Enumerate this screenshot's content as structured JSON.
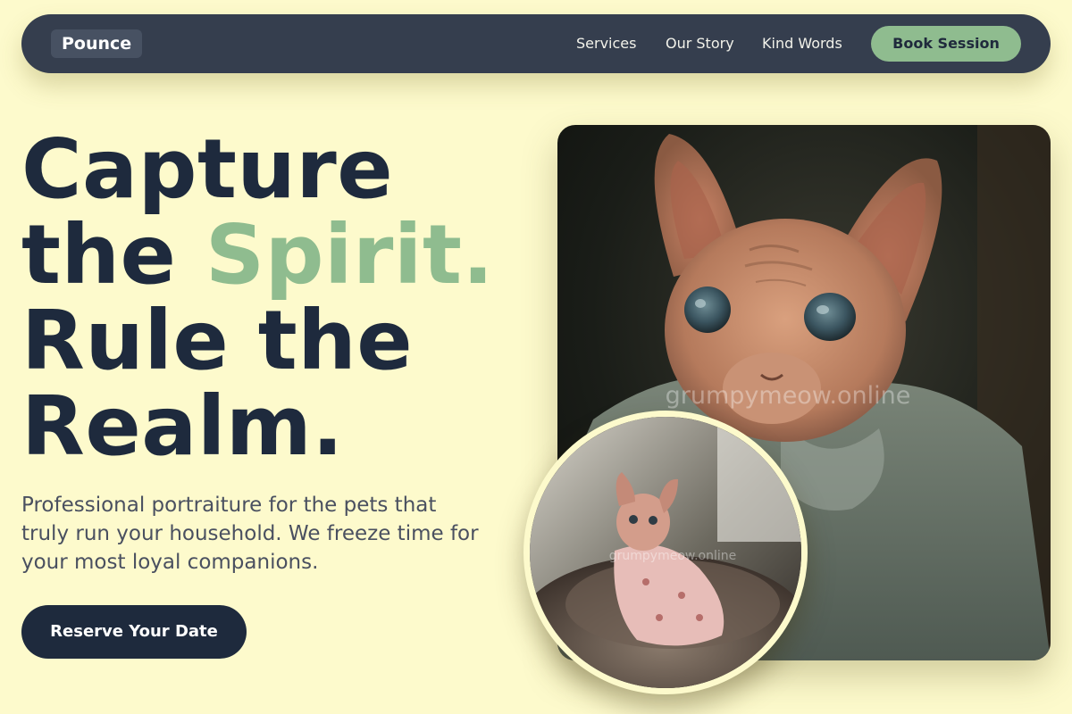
{
  "nav": {
    "logo": "Pounce",
    "links": [
      "Services",
      "Our Story",
      "Kind Words"
    ],
    "cta": "Book Session"
  },
  "hero": {
    "headline_line1": "Capture",
    "headline_line2_a": "the ",
    "headline_line2_accent": "Spirit.",
    "headline_line3": "Rule the",
    "headline_line4": "Realm.",
    "subtitle": "Professional portraiture for the pets that truly run your household. We freeze time for your most loyal companions.",
    "cta": "Reserve Your Date"
  },
  "images": {
    "main_watermark": "grumpymeow.online",
    "circle_watermark": "grumpymeow.online"
  },
  "colors": {
    "background": "#fdfacc",
    "nav": "#353e4e",
    "accent": "#8fbc8f",
    "text_dark": "#1e2a3d"
  }
}
